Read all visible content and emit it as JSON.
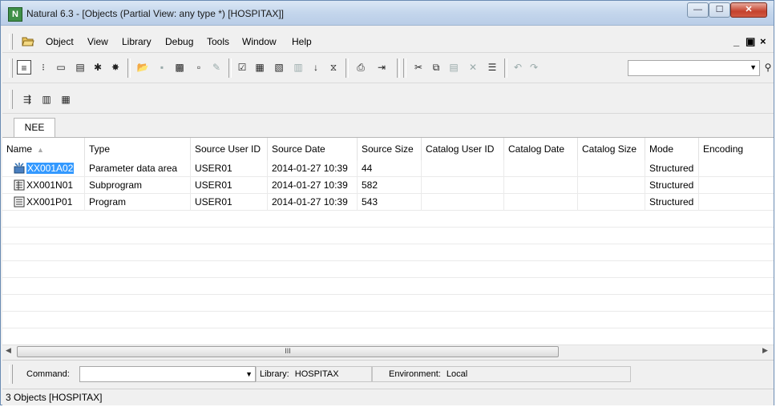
{
  "window": {
    "title": "Natural 6.3 - [Objects (Partial View: any type *)  [HOSPITAX]]",
    "app_icon_letter": "N"
  },
  "menubar": {
    "items": [
      "Object",
      "View",
      "Library",
      "Debug",
      "Tools",
      "Window",
      "Help"
    ],
    "mdi_controls": "_ | ਭ | x"
  },
  "toolbar": {
    "search_icon_name": "binoculars-icon"
  },
  "tab": {
    "label": "NEE"
  },
  "list": {
    "headers": [
      "Name",
      "Type",
      "Source User ID",
      "Source Date",
      "Source Size",
      "Catalog User ID",
      "Catalog Date",
      "Catalog Size",
      "Mode",
      "Encoding"
    ],
    "rows": [
      {
        "name": "XX001A02",
        "type": "Parameter data area",
        "source_user_id": "USER01",
        "source_date": "2014-01-27 10:39",
        "source_size": "44",
        "catalog_user_id": "",
        "catalog_date": "",
        "catalog_size": "",
        "mode": "Structured",
        "encoding": "",
        "icon": "parameter-data-area-icon",
        "selected": true
      },
      {
        "name": "XX001N01",
        "type": "Subprogram",
        "source_user_id": "USER01",
        "source_date": "2014-01-27 10:39",
        "source_size": "582",
        "catalog_user_id": "",
        "catalog_date": "",
        "catalog_size": "",
        "mode": "Structured",
        "encoding": "",
        "icon": "subprogram-icon",
        "selected": false
      },
      {
        "name": "XX001P01",
        "type": "Program",
        "source_user_id": "USER01",
        "source_date": "2014-01-27 10:39",
        "source_size": "543",
        "catalog_user_id": "",
        "catalog_date": "",
        "catalog_size": "",
        "mode": "Structured",
        "encoding": "",
        "icon": "program-icon",
        "selected": false
      }
    ]
  },
  "scrollbar": {
    "thumb_grip": "III"
  },
  "command_bar": {
    "command_label": "Command:",
    "command_value": "",
    "library_label": "Library:",
    "library_value": "HOSPITAX",
    "environment_label": "Environment:",
    "environment_value": "Local"
  },
  "statusbar": {
    "text": "3 Objects  [HOSPITAX]"
  },
  "colors": {
    "selection": "#3399ff",
    "title_gradient_top": "#dbe7f5",
    "close_button": "#c5422d"
  }
}
